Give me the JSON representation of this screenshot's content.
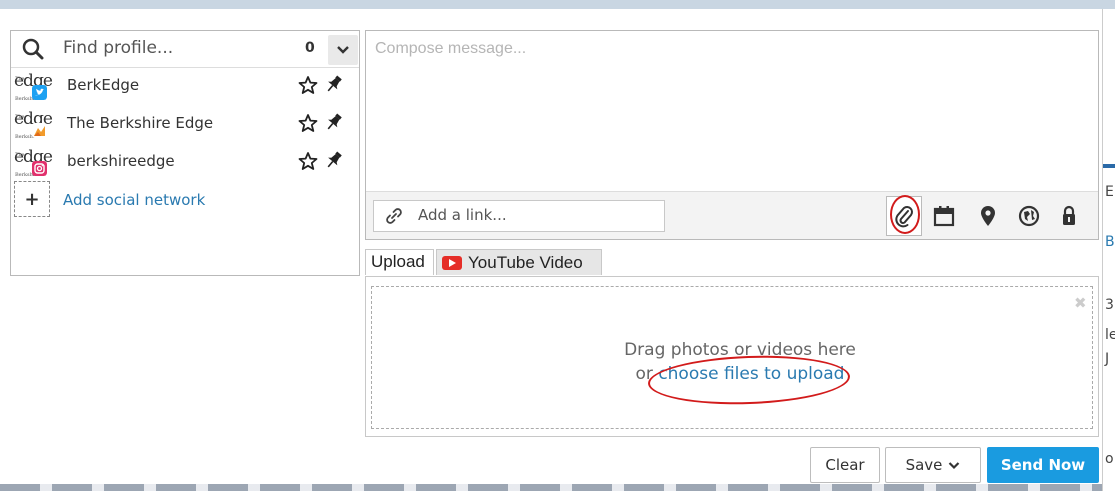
{
  "profile_picker": {
    "search_placeholder": "Find profile...",
    "selected_count": "0",
    "profiles": [
      {
        "name": "BerkEdge",
        "network": "twitter",
        "avatar_text": "edge",
        "avatar_tiny": "The Berkshire",
        "badge_color": "#1da1f2"
      },
      {
        "name": "The Berkshire Edge",
        "network": "facebook-page",
        "avatar_text": "edge",
        "avatar_tiny": "The Berkshire",
        "badge_color": "#f29b2b"
      },
      {
        "name": "berkshireedge",
        "network": "instagram",
        "avatar_text": "edge",
        "avatar_tiny": "The Berkshire",
        "badge_color": "#e1306c"
      }
    ],
    "add_network_label": "Add social network",
    "add_network_symbol": "+"
  },
  "composer": {
    "message_placeholder": "Compose message...",
    "link_placeholder": "Add a link...",
    "tools": [
      "attach-icon",
      "calendar-icon",
      "location-icon",
      "targeting-icon",
      "privacy-lock-icon"
    ]
  },
  "media": {
    "tabs": [
      {
        "label": "Upload",
        "active": true
      },
      {
        "label": "YouTube Video",
        "active": false
      }
    ],
    "drop_line1": "Drag photos or videos here",
    "drop_prefix": "or ",
    "upload_link": "choose files to upload",
    "close_symbol": "✖"
  },
  "actions": {
    "clear_label": "Clear",
    "save_label": "Save",
    "send_label": "Send Now"
  },
  "right_edge_fragments": [
    "E",
    "Bo",
    "3",
    "le",
    "J",
    "o"
  ],
  "colors": {
    "accent": "#1a9be0",
    "link": "#2a7ab0",
    "annotation": "#d21b1b"
  }
}
